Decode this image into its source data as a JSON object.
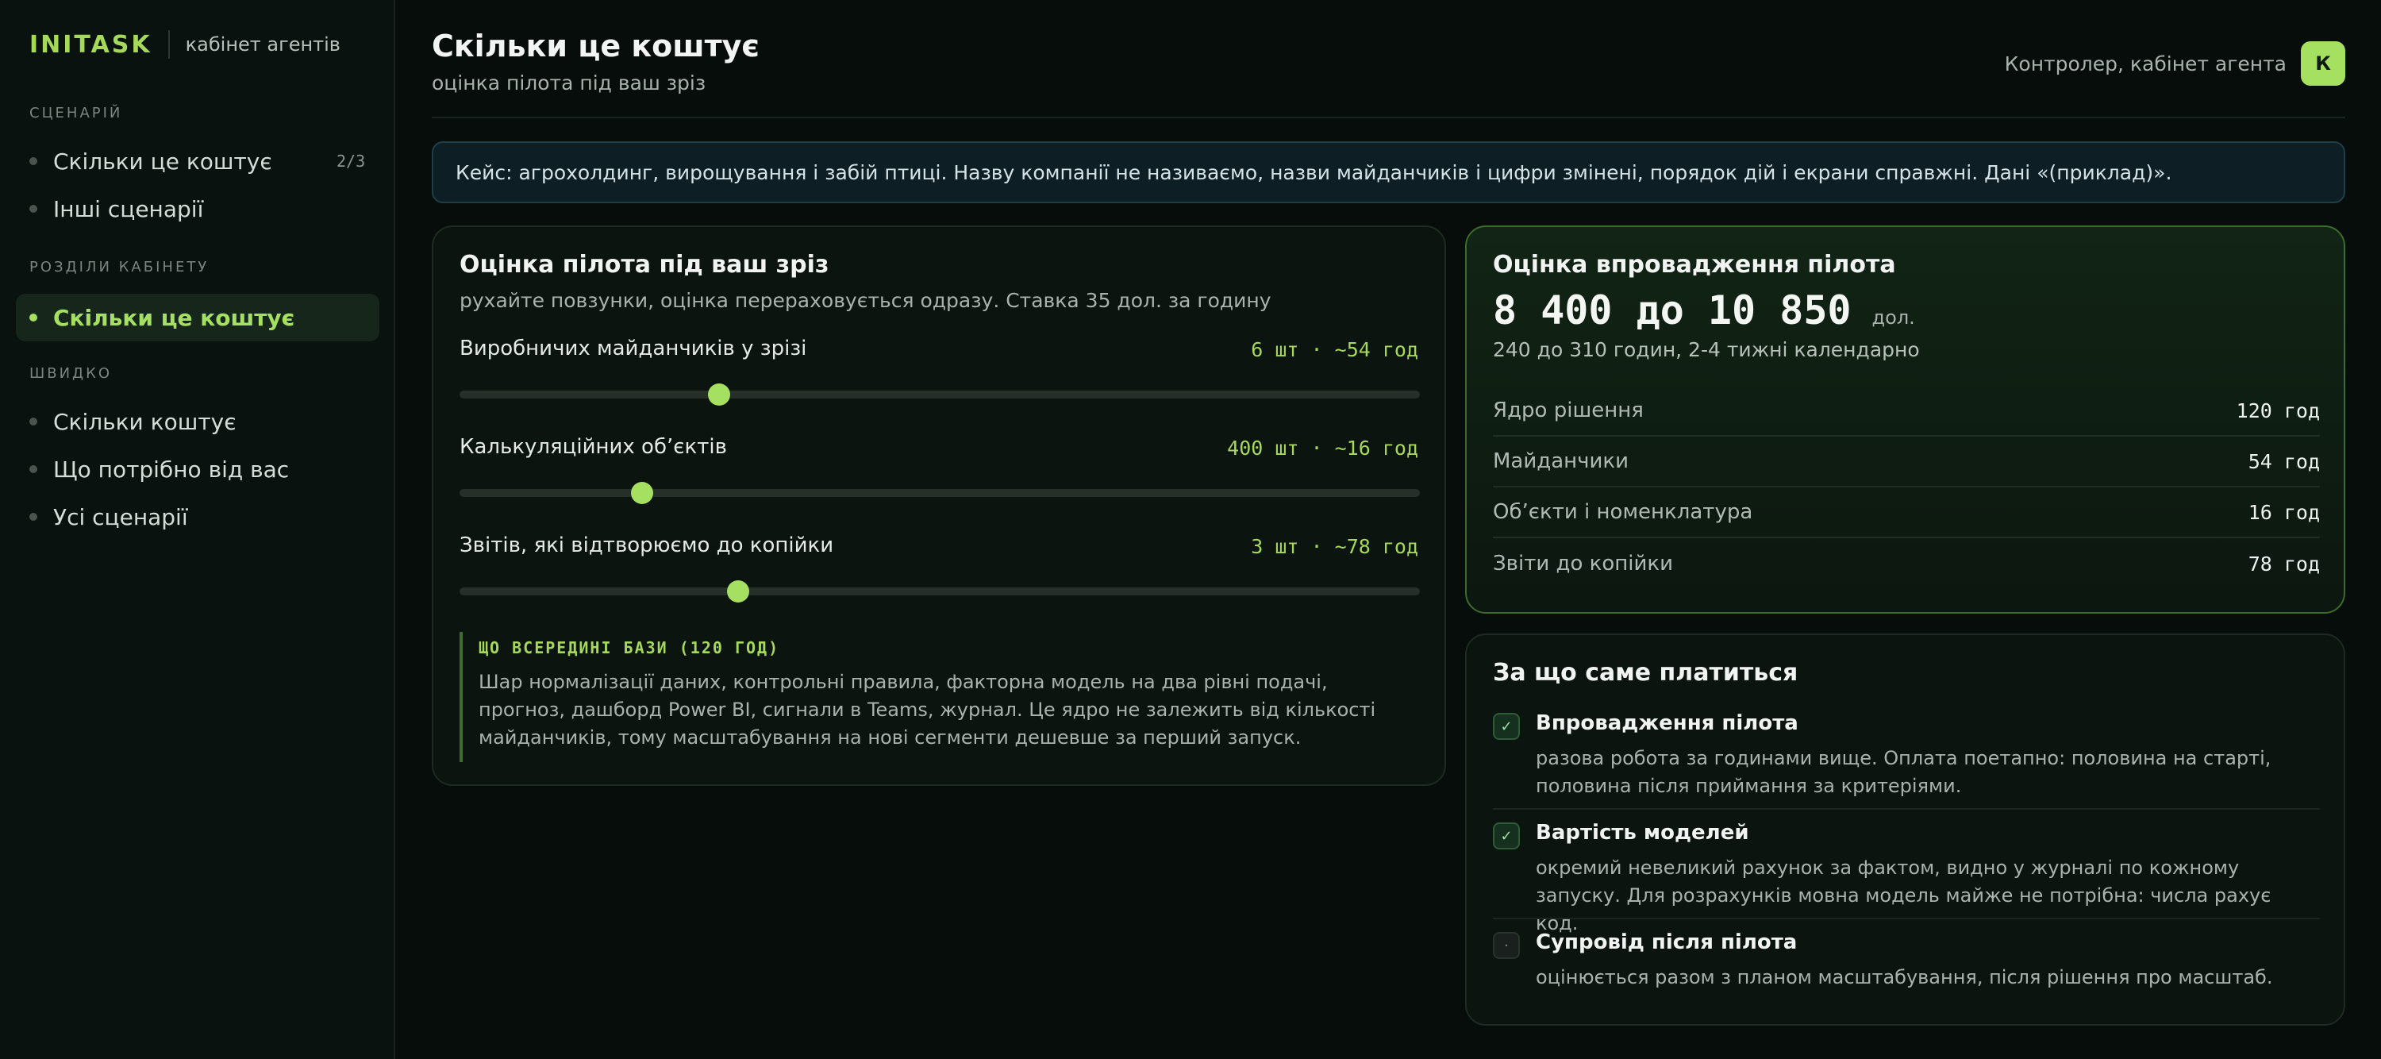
{
  "brand": {
    "logo": "INITASK",
    "subtitle": "кабінет агентів"
  },
  "sidebar": {
    "sections": {
      "scenarios": "СЦЕНАРІЙ",
      "cabinet": "РОЗДІЛИ КАБІНЕТУ",
      "quick": "ШВИДКО"
    },
    "scenario_items": [
      {
        "label": "Скільки це коштує",
        "badge": "2/3"
      },
      {
        "label": "Інші сценарії"
      }
    ],
    "cabinet_items": [
      {
        "label": "Скільки це коштує",
        "active": true
      }
    ],
    "quick_items": [
      {
        "label": "Скільки коштує"
      },
      {
        "label": "Що потрібно від вас"
      },
      {
        "label": "Усі сценарії"
      }
    ]
  },
  "header": {
    "title": "Скільки це коштує",
    "subtitle": "оцінка пілота під ваш зріз",
    "user_label": "Контролер, кабінет агента",
    "avatar_letter": "К"
  },
  "banner": "Кейс: агрохолдинг, вирощування і забій птиці. Назву компанії не називаємо, назви майданчиків і цифри змінені, порядок дій і екрани справжні. Дані «(приклад)».",
  "estimator": {
    "title": "Оцінка пілота під ваш зріз",
    "description": "рухайте повзунки, оцінка перераховується одразу. Ставка 35 дол. за годину",
    "sliders": [
      {
        "label": "Виробничих майданчиків у зрізі",
        "value_text": "6 шт · ~54 год",
        "level": 0.27
      },
      {
        "label": "Калькуляційних обʼєктів",
        "value_text": "400 шт · ~16 год",
        "level": 0.19
      },
      {
        "label": "Звітів, які відтворюємо до копійки",
        "value_text": "3 шт · ~78 год",
        "level": 0.29
      }
    ],
    "note": {
      "title": "ЩО ВСЕРЕДИНІ БАЗИ (120 ГОД)",
      "text": "Шар нормалізації даних, контрольні правила, факторна модель на два рівні подачі, прогноз, дашборд Power BI, сигнали в Teams, журнал. Це ядро не залежить від кількості майданчиків, тому масштабування на нові сегменти дешевше за перший запуск."
    }
  },
  "estimate": {
    "title": "Оцінка впровадження пілота",
    "value": "8 400 до 10 850",
    "unit": "дол.",
    "subtitle": "240 до 310 годин, 2-4 тижні календарно",
    "rows": [
      {
        "label": "Ядро рішення",
        "value": "120 год"
      },
      {
        "label": "Майданчики",
        "value": "54 год"
      },
      {
        "label": "Обʼєкти і номенклатура",
        "value": "16 год"
      },
      {
        "label": "Звіти до копійки",
        "value": "78 год"
      }
    ]
  },
  "pay": {
    "title": "За що саме платиться",
    "items": [
      {
        "title": "Впровадження пілота",
        "text": "разова робота за годинами вище. Оплата поетапно: половина на старті, половина після приймання за критеріями.",
        "checked": true,
        "mark": "✓"
      },
      {
        "title": "Вартість моделей",
        "text": "окремий невеликий рахунок за фактом, видно у журналі по кожному запуску. Для розрахунків мовна модель майже не потрібна: числа рахує код.",
        "checked": true,
        "mark": "✓"
      },
      {
        "title": "Супровід після пілота",
        "text": "оцінюється разом з планом масштабування, після рішення про масштаб.",
        "checked": false,
        "mark": "·"
      }
    ]
  }
}
